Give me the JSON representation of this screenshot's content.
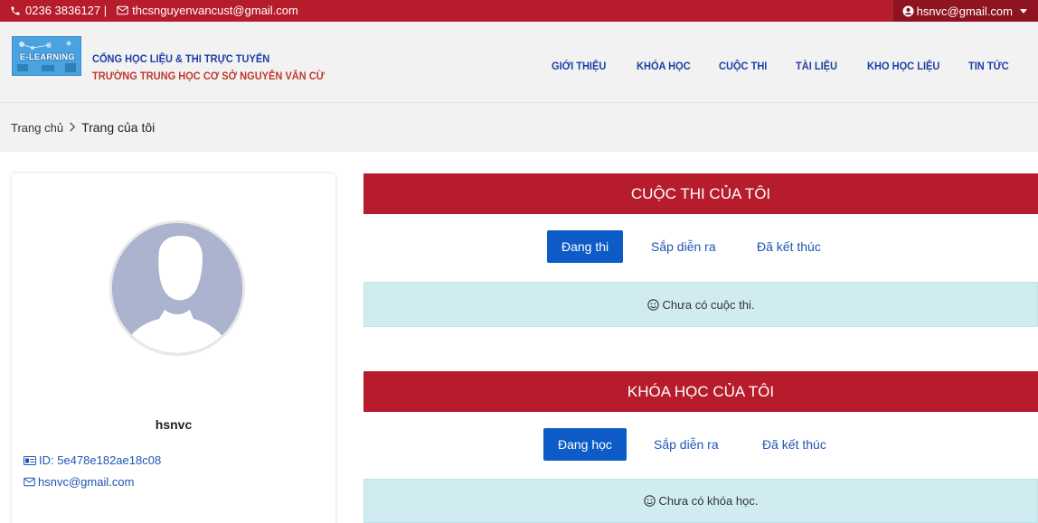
{
  "topbar": {
    "phone": "0236 3836127 |",
    "email": "thcsnguyenvancust@gmail.com",
    "user": "hsnvc@gmail.com"
  },
  "header": {
    "logo_text": "E-LEARNING",
    "brand_line1": "CỔNG HỌC LIỆU & THI TRỰC TUYẾN",
    "brand_line2": "TRƯỜNG TRUNG HỌC CƠ SỞ NGUYỄN VĂN CỪ",
    "nav": [
      "GIỚI THIỆU",
      "KHÓA HỌC",
      "CUỘC THI",
      "TÀI LIỆU",
      "KHO HỌC LIỆU",
      "TIN TỨC"
    ]
  },
  "breadcrumb": {
    "home": "Trang chủ",
    "current": "Trang của tôi"
  },
  "profile": {
    "name": "hsnvc",
    "id": "ID: 5e478e182ae18c08",
    "email": "hsnvc@gmail.com"
  },
  "contests": {
    "title": "CUỘC THI CỦA TÔI",
    "tabs": [
      "Đang thi",
      "Sắp diễn ra",
      "Đã kết thúc"
    ],
    "empty": "Chưa có cuộc thi."
  },
  "courses": {
    "title": "KHÓA HỌC CỦA TÔI",
    "tabs": [
      "Đang học",
      "Sắp diễn ra",
      "Đã kết thúc"
    ],
    "empty": "Chưa có khóa học."
  },
  "colors": {
    "primary_red": "#b71c2c",
    "nav_blue": "#1e3ea8",
    "active_tab": "#0d5bc6",
    "alert_bg": "#d1ecf1"
  }
}
